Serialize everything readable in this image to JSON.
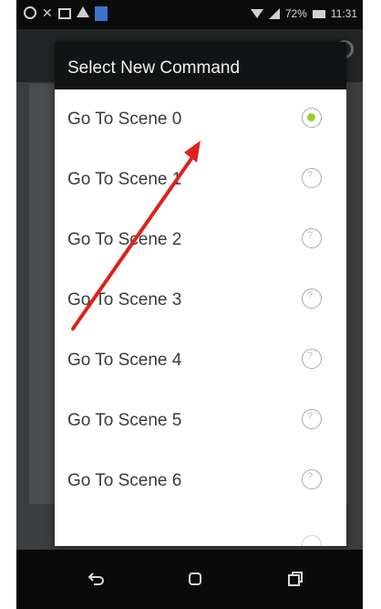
{
  "dialog": {
    "title": "Select New Command",
    "options": [
      {
        "label": "Go To Scene 0",
        "selected": true
      },
      {
        "label": "Go To Scene 1",
        "selected": false
      },
      {
        "label": "Go To Scene 2",
        "selected": false
      },
      {
        "label": "Go To Scene 3",
        "selected": false
      },
      {
        "label": "Go To Scene 4",
        "selected": false
      },
      {
        "label": "Go To Scene 5",
        "selected": false
      },
      {
        "label": "Go To Scene 6",
        "selected": false
      }
    ]
  },
  "status_bar": {
    "battery": "72%",
    "time": "11:31"
  },
  "colors": {
    "radio_selected": "#9acd32",
    "annotation_arrow": "#e0201c"
  },
  "icons": [
    "whatsapp-icon",
    "close-icon",
    "image-icon",
    "warning-icon",
    "app-icon",
    "wifi-icon",
    "signal-icon",
    "battery-icon",
    "settings-icon",
    "back-icon",
    "home-icon",
    "recents-icon"
  ]
}
